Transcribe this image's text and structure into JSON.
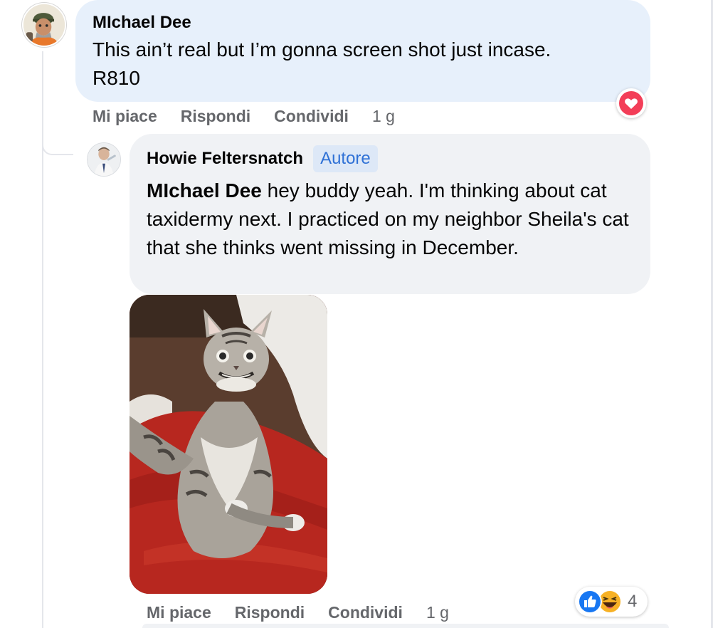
{
  "comments": [
    {
      "author": "MIchael Dee",
      "lines": [
        "This ain’t real but I’m gonna screen shot just incase.",
        "R810"
      ],
      "actions": {
        "like": "Mi piace",
        "reply": "Rispondi",
        "share": "Condividi",
        "time": "1 g"
      },
      "reactions": {
        "icons": [
          "heart-reaction"
        ]
      }
    },
    {
      "author": "Howie Feltersnatch",
      "badge": "Autore",
      "mention": "MIchael Dee",
      "text": " hey buddy yeah. I'm thinking about cat taxidermy next. I practiced on my neighbor Sheila's cat that she thinks went missing in December.",
      "actions": {
        "like": "Mi piace",
        "reply": "Rispondi",
        "share": "Condividi",
        "time": "1 g"
      },
      "reactions": {
        "icons": [
          "like-reaction",
          "haha-reaction"
        ],
        "count": "4"
      }
    }
  ],
  "colors": {
    "bubble_highlight": "#e7f0fb",
    "bubble": "#f0f2f5",
    "secondary_text": "#65676b",
    "badge_text": "#2f71d6",
    "badge_bg": "#dde8f7",
    "like_blue": "#1877f2",
    "heart_red": "#f33e58"
  }
}
